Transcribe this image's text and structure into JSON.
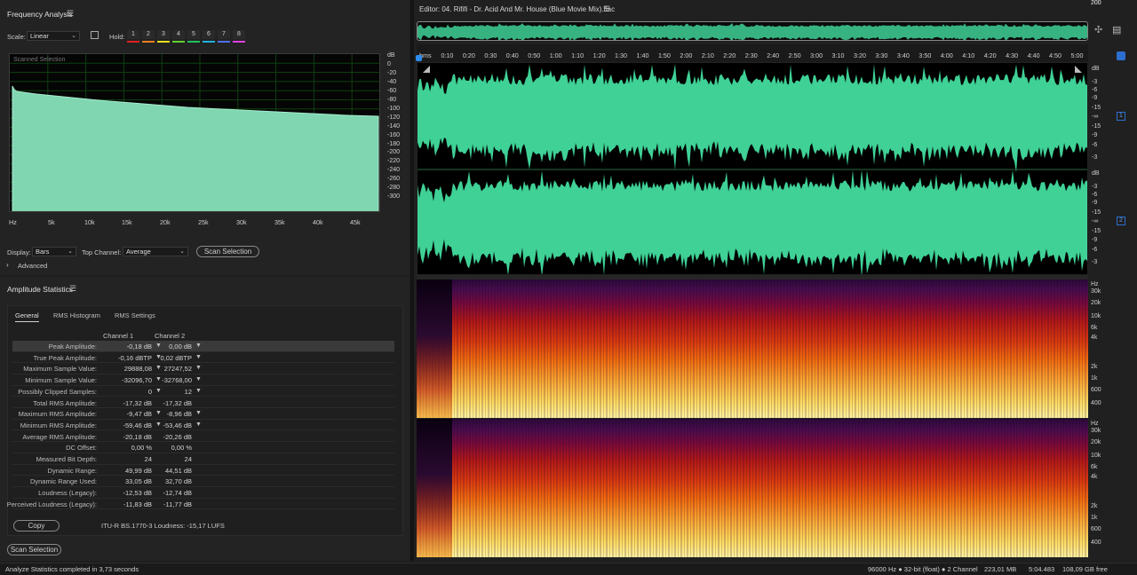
{
  "freq": {
    "title": "Frequency Analysis",
    "scale_label": "Scale:",
    "scale_value": "Linear",
    "hold_label": "Hold:",
    "hold_buttons": [
      "1",
      "2",
      "3",
      "4",
      "5",
      "6",
      "7",
      "8"
    ],
    "hold_colors": [
      "#e02020",
      "#f08020",
      "#e8e020",
      "#60d030",
      "#20c060",
      "#20b0e0",
      "#5070f0",
      "#e040e0"
    ],
    "scanned_label": "Scanned Selection",
    "db_ticks": [
      "dB",
      "0",
      "-20",
      "-40",
      "-60",
      "-80",
      "-100",
      "-120",
      "-140",
      "-160",
      "-180",
      "-200",
      "-220",
      "-240",
      "-260",
      "-280",
      "-300"
    ],
    "hz_ticks": [
      "Hz",
      "5k",
      "10k",
      "15k",
      "20k",
      "25k",
      "30k",
      "35k",
      "40k",
      "45k"
    ],
    "display_label": "Display:",
    "display_value": "Bars",
    "top_channel_label": "Top Channel:",
    "top_channel_value": "Average",
    "scan_button": "Scan Selection",
    "advanced_label": "Advanced"
  },
  "stats": {
    "title": "Amplitude Statistics",
    "tabs": [
      "General",
      "RMS Histogram",
      "RMS Settings"
    ],
    "col1": "Channel 1",
    "col2": "Channel 2",
    "rows": [
      {
        "label": "Peak Amplitude:",
        "c1": "-0,18 dB",
        "c2": "0,00 dB"
      },
      {
        "label": "True Peak Amplitude:",
        "c1": "-0,16 dBTP",
        "c2": "0,02 dBTP"
      },
      {
        "label": "Maximum Sample Value:",
        "c1": "29888,08",
        "c2": "27247,52"
      },
      {
        "label": "Minimum Sample Value:",
        "c1": "-32096,70",
        "c2": "-32768,00"
      },
      {
        "label": "Possibly Clipped Samples:",
        "c1": "0",
        "c2": "12"
      },
      {
        "label": "Total RMS Amplitude:",
        "c1": "-17,32 dB",
        "c2": "-17,32 dB"
      },
      {
        "label": "Maximum RMS Amplitude:",
        "c1": "-9,47 dB",
        "c2": "-8,96 dB"
      },
      {
        "label": "Minimum RMS Amplitude:",
        "c1": "-59,46 dB",
        "c2": "-53,46 dB"
      },
      {
        "label": "Average RMS Amplitude:",
        "c1": "-20,18 dB",
        "c2": "-20,26 dB"
      },
      {
        "label": "DC Offset:",
        "c1": "0,00 %",
        "c2": "0,00 %"
      },
      {
        "label": "Measured Bit Depth:",
        "c1": "24",
        "c2": "24"
      },
      {
        "label": "Dynamic Range:",
        "c1": "49,99 dB",
        "c2": "44,51 dB"
      },
      {
        "label": "Dynamic Range Used:",
        "c1": "33,05 dB",
        "c2": "32,70 dB"
      },
      {
        "label": "Loudness (Legacy):",
        "c1": "-12,53 dB",
        "c2": "-12,74 dB"
      },
      {
        "label": "Perceived Loudness (Legacy):",
        "c1": "-11,83 dB",
        "c2": "-11,77 dB"
      }
    ],
    "copy_button": "Copy",
    "itu_text": "ITU-R BS.1770-3 Loudness: -15,17 LUFS",
    "scan_button": "Scan Selection"
  },
  "editor": {
    "title": "Editor: 04. Rififi - Dr. Acid And Mr. House (Blue Movie Mix).flac",
    "time_ticks": [
      "hms",
      "0:10",
      "0:20",
      "0:30",
      "0:40",
      "0:50",
      "1:00",
      "1:10",
      "1:20",
      "1:30",
      "1:40",
      "1:50",
      "2:00",
      "2:10",
      "2:20",
      "2:30",
      "2:40",
      "2:50",
      "3:00",
      "3:10",
      "3:20",
      "3:30",
      "3:40",
      "3:50",
      "4:00",
      "4:10",
      "4:20",
      "4:30",
      "4:40",
      "4:50",
      "5:00"
    ],
    "db_ticks_ch": [
      "dB",
      "-3",
      "-6",
      "-9",
      "-15",
      "-∞",
      "-15",
      "-9",
      "-6",
      "-3"
    ],
    "channel_labels": [
      "1",
      "2"
    ],
    "hz_ticks_spec": [
      "Hz",
      "30k",
      "20k",
      "10k",
      "6k",
      "4k",
      "2k",
      "1k",
      "600",
      "400",
      "200"
    ]
  },
  "status": {
    "message": "Analyze Statistics completed in 3,73 seconds",
    "sample_info": "96000 Hz ● 32-bit (float) ● 2 Channel",
    "size": "223,01 MB",
    "duration": "5:04.483",
    "free": "108,09 GB free"
  },
  "colors": {
    "waveform": "#3fd196",
    "accent": "#2d8cf0"
  }
}
